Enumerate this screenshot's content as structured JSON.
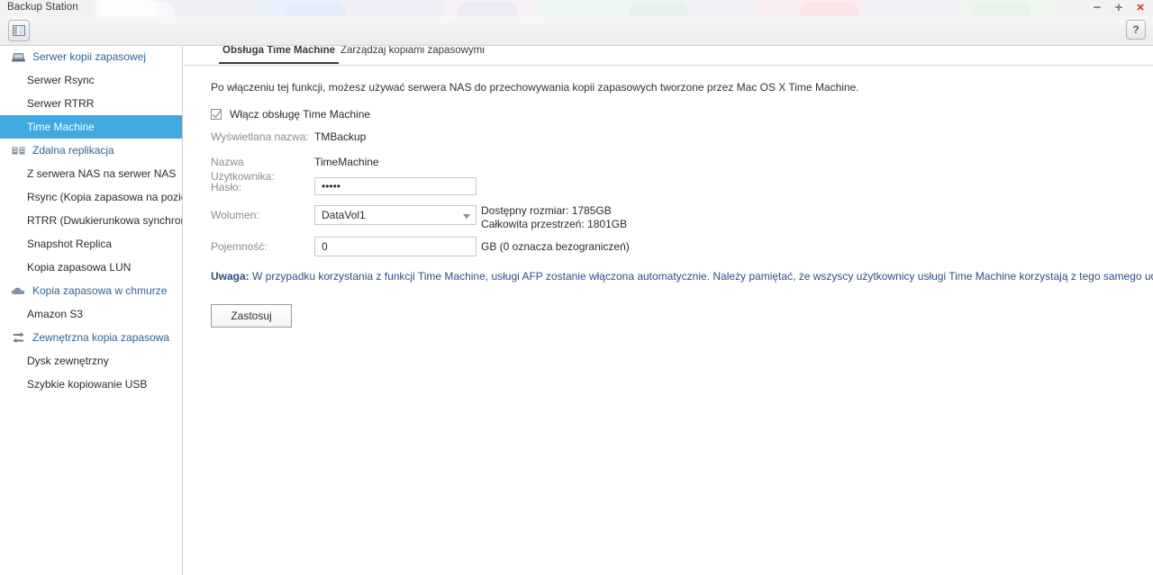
{
  "window": {
    "title": "Backup Station",
    "minimize_label": "−",
    "maximize_label": "+",
    "close_label": "×",
    "help_label": "?"
  },
  "toolbar": {
    "panel_toggle_name": "panel-layout-icon"
  },
  "sidebar": {
    "groups": [
      {
        "label": "Serwer kopii zapasowej",
        "icon": "server-icon",
        "items": [
          {
            "label": "Serwer Rsync",
            "selected": false
          },
          {
            "label": "Serwer RTRR",
            "selected": false
          },
          {
            "label": "Time Machine",
            "selected": true
          }
        ]
      },
      {
        "label": "Zdalna replikacja",
        "icon": "replication-icon",
        "items": [
          {
            "label": "Z serwera NAS na serwer NAS",
            "selected": false
          },
          {
            "label": "Rsync (Kopia zapasowa na pozio...",
            "selected": false
          },
          {
            "label": "RTRR (Dwukierunkowa synchroni...",
            "selected": false
          },
          {
            "label": "Snapshot Replica",
            "selected": false
          },
          {
            "label": "Kopia zapasowa LUN",
            "selected": false
          }
        ]
      },
      {
        "label": "Kopia zapasowa w chmurze",
        "icon": "cloud-icon",
        "items": [
          {
            "label": "Amazon S3",
            "selected": false
          }
        ]
      },
      {
        "label": "Zewnętrzna kopia zapasowa",
        "icon": "sync-arrows-icon",
        "items": [
          {
            "label": "Dysk zewnętrzny",
            "selected": false
          },
          {
            "label": "Szybkie kopiowanie USB",
            "selected": false
          }
        ]
      }
    ]
  },
  "main": {
    "tabs": [
      {
        "label": "Obsługa Time Machine",
        "active": true
      },
      {
        "label": "Zarządzaj kopiami zapasowymi",
        "active": false
      }
    ],
    "intro": "Po włączeniu tej funkcji, możesz używać serwera NAS do przechowywania kopii zapasowych tworzone przez Mac OS X Time Machine.",
    "enable_checkbox": {
      "label": "Włącz obsługę Time Machine",
      "checked": true
    },
    "fields": {
      "display_name_label": "Wyświetlana nazwa:",
      "display_name_value": "TMBackup",
      "username_label": "Nazwa Użytkownika:",
      "username_value": "TimeMachine",
      "password_label": "Hasło:",
      "password_value": "•••••",
      "volume_label": "Wolumen:",
      "volume_value": "DataVol1",
      "volume_available": "Dostępny rozmiar: 1785GB",
      "volume_total": "Całkowita przestrzeń: 1801GB",
      "capacity_label": "Pojemność:",
      "capacity_value": "0",
      "capacity_unit_note": "GB (0 oznacza bezograniczeń)"
    },
    "warning_prefix": "Uwaga:",
    "warning_text": " W przypadku korzystania z funkcji Time Machine, usługi AFP zostanie włączona automatycznie. Należy pamiętać, że wszyscy użytkownicy usługi Time Machine korzystają z tego samego udziału sieciowego.",
    "apply_label": "Zastosuj"
  },
  "colors": {
    "selection_blue": "#3fa9e0",
    "group_label_blue": "#2e6496",
    "warning_blue": "#2e4e86",
    "close_red": "#d0332f"
  }
}
